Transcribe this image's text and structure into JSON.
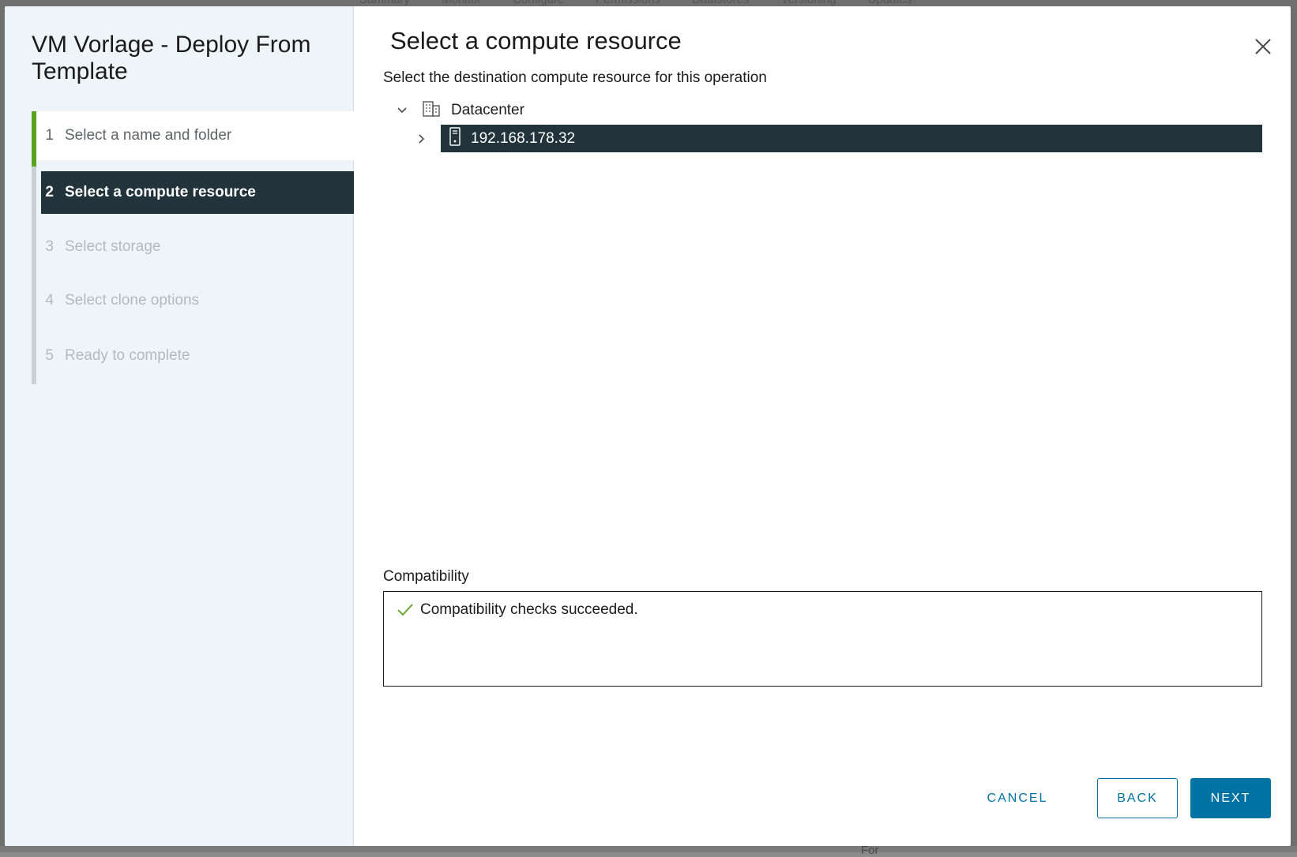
{
  "background": {
    "tabs": [
      "Summary",
      "Monitor",
      "Configure",
      "Permissions",
      "Datastores",
      "Versioning",
      "Updates"
    ],
    "bottom_text": "For"
  },
  "wizard": {
    "title": "VM Vorlage - Deploy From Template",
    "steps": [
      {
        "num": "1",
        "label": "Select a name and folder",
        "state": "done"
      },
      {
        "num": "2",
        "label": "Select a compute resource",
        "state": "active"
      },
      {
        "num": "3",
        "label": "Select storage",
        "state": "pending"
      },
      {
        "num": "4",
        "label": "Select clone options",
        "state": "pending"
      },
      {
        "num": "5",
        "label": "Ready to complete",
        "state": "pending"
      }
    ]
  },
  "main": {
    "title": "Select a compute resource",
    "subtitle": "Select the destination compute resource for this operation",
    "tree": {
      "datacenter": {
        "label": "Datacenter",
        "icon": "datacenter-icon",
        "expanded": true
      },
      "host": {
        "label": "192.168.178.32",
        "icon": "host-icon",
        "selected": true
      }
    },
    "compatibility": {
      "label": "Compatibility",
      "message": "Compatibility checks succeeded.",
      "status_color": "#5aa220"
    }
  },
  "footer": {
    "cancel": "CANCEL",
    "back": "BACK",
    "next": "NEXT"
  },
  "colors": {
    "accent": "#0072a3",
    "selected_bg": "#22333b",
    "done_track": "#5aa220"
  }
}
